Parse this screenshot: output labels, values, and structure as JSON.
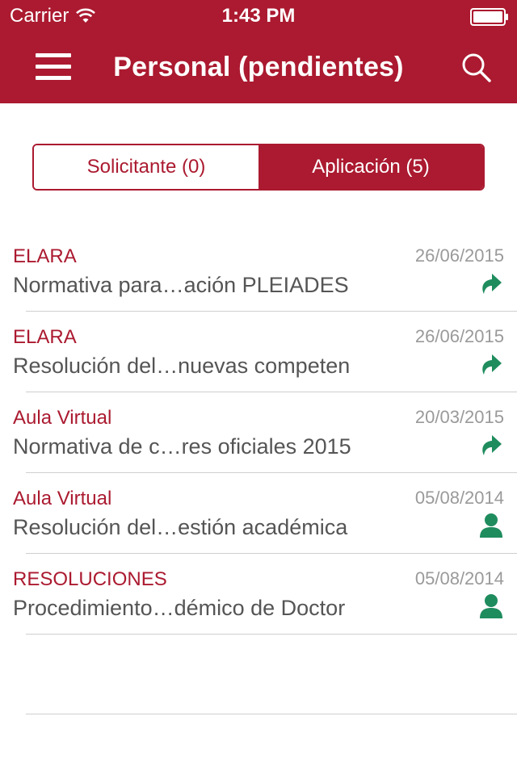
{
  "status_bar": {
    "carrier": "Carrier",
    "time": "1:43 PM"
  },
  "nav": {
    "title": "Personal (pendientes)",
    "menu_icon": "hamburger-menu-icon",
    "search_icon": "search-icon"
  },
  "segments": {
    "solicitante": "Solicitante (0)",
    "aplicacion": "Aplicación (5)",
    "selected": "aplicacion"
  },
  "items": [
    {
      "category": "ELARA",
      "date": "26/06/2015",
      "title": "Normativa para…ación PLEIADES",
      "icon": "forward-arrow-icon"
    },
    {
      "category": "ELARA",
      "date": "26/06/2015",
      "title": "Resolución del…nuevas competen",
      "icon": "forward-arrow-icon"
    },
    {
      "category": "Aula Virtual",
      "date": "20/03/2015",
      "title": "Normativa de c…res oficiales 2015",
      "icon": "forward-arrow-icon"
    },
    {
      "category": "Aula Virtual",
      "date": "05/08/2014",
      "title": "Resolución del…estión académica",
      "icon": "person-icon"
    },
    {
      "category": "RESOLUCIONES",
      "date": "05/08/2014",
      "title": "Procedimiento…démico de Doctor",
      "icon": "person-icon"
    }
  ],
  "colors": {
    "brand": "#ab1a30",
    "icon": "#1f8c5e",
    "date": "#9a9a9a",
    "title": "#555555"
  }
}
